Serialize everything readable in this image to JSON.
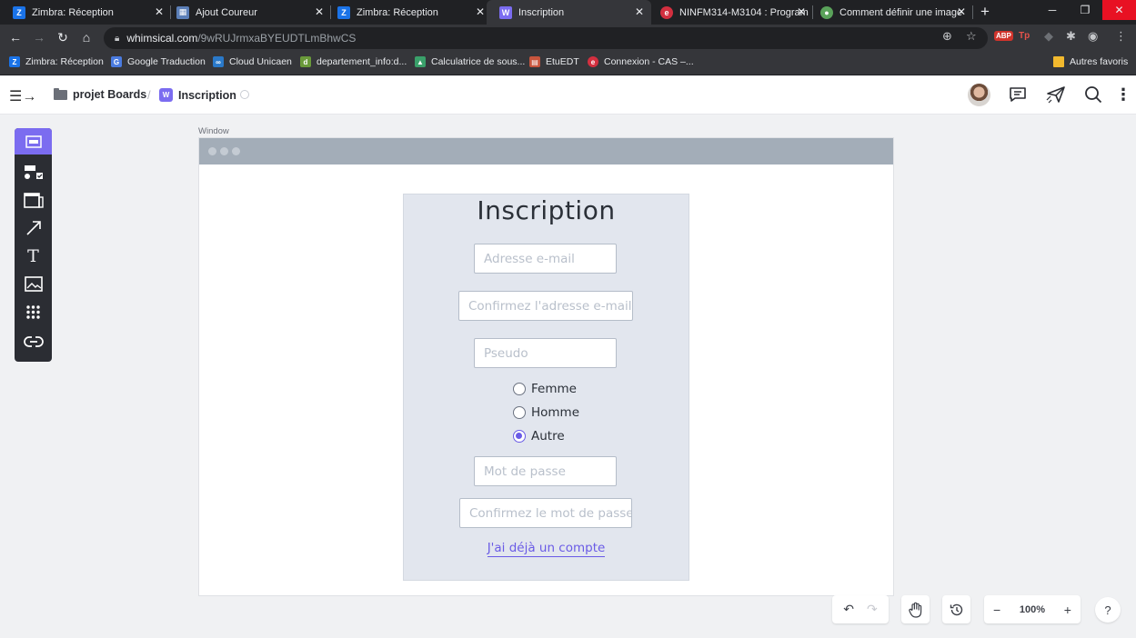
{
  "browser": {
    "tabs": [
      {
        "label": "Zimbra: Réception",
        "icon": "Z",
        "color": "#1a73e8"
      },
      {
        "label": "Ajout Coureur",
        "icon": "▦",
        "color": "#5b7fb8"
      },
      {
        "label": "Zimbra: Réception",
        "icon": "Z",
        "color": "#1a73e8"
      },
      {
        "label": "Inscription",
        "icon": "W",
        "color": "#7b6cf0"
      },
      {
        "label": "NINFM314-M3104 : Program",
        "icon": "e",
        "color": "#d32f3f"
      },
      {
        "label": "Comment définir une image",
        "icon": "●",
        "color": "#5aa25a"
      }
    ],
    "url_host": "whimsical.com",
    "url_path": "/9wRUJrmxaBYEUDTLmBhwCS",
    "bookmarks": [
      {
        "label": "Zimbra: Réception",
        "icon": "Z",
        "color": "#1a73e8"
      },
      {
        "label": "Google Traduction",
        "icon": "G",
        "color": "#4a7be0"
      },
      {
        "label": "Cloud Unicaen",
        "icon": "∞",
        "color": "#2a79c9"
      },
      {
        "label": "departement_info:d...",
        "icon": "d",
        "color": "#6a9a3a"
      },
      {
        "label": "Calculatrice de sous...",
        "icon": "▲",
        "color": "#3aa06a"
      },
      {
        "label": "EtuEDT",
        "icon": "▤",
        "color": "#c8553d"
      },
      {
        "label": "Connexion - CAS –...",
        "icon": "e",
        "color": "#d32f3f"
      }
    ],
    "other_bookmarks": "Autres favoris"
  },
  "app": {
    "folder": "projet Boards",
    "separator": "/",
    "board": "Inscription",
    "board_badge": "W"
  },
  "window": {
    "label": "Window"
  },
  "form": {
    "title": "Inscription",
    "email_placeholder": "Adresse e-mail",
    "confirm_email_placeholder": "Confirmez l'adresse e-mail",
    "pseudo_placeholder": "Pseudo",
    "gender_options": [
      "Femme",
      "Homme",
      "Autre"
    ],
    "gender_selected": "Autre",
    "password_placeholder": "Mot de passe",
    "confirm_password_placeholder": "Confirmez le mot de passe",
    "login_link": "J'ai déjà un compte"
  },
  "controls": {
    "zoom": "100%",
    "help": "?"
  },
  "colors": {
    "accent": "#7b6cf0",
    "radio_accent": "#6a5be6"
  }
}
